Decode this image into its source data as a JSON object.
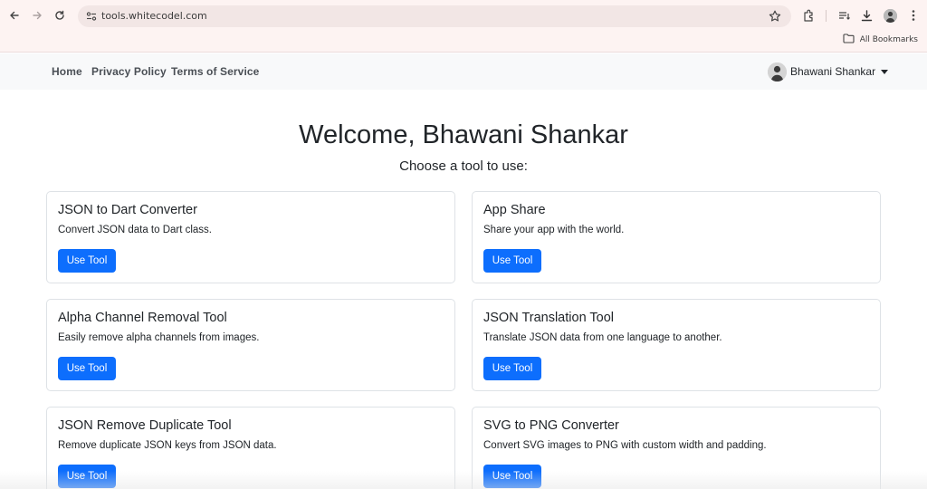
{
  "browser": {
    "url": "tools.whitecodel.com",
    "bookmarks_label": "All Bookmarks",
    "icons": [
      "back-icon",
      "forward-icon",
      "reload-icon",
      "site-info-icon",
      "bookmark-star-icon",
      "extensions-icon",
      "reading-list-icon",
      "download-icon",
      "profile-avatar",
      "more-menu-icon",
      "folder-icon"
    ]
  },
  "navbar": {
    "links": [
      "Home",
      "Privacy Policy",
      "Terms of Service"
    ],
    "user_name": "Bhawani Shankar"
  },
  "main": {
    "title": "Welcome, Bhawani Shankar",
    "subtitle": "Choose a tool to use:",
    "button_label": "Use Tool",
    "tools": [
      {
        "title": "JSON to Dart Converter",
        "description": "Convert JSON data to Dart class."
      },
      {
        "title": "App Share",
        "description": "Share your app with the world."
      },
      {
        "title": "Alpha Channel Removal Tool",
        "description": "Easily remove alpha channels from images."
      },
      {
        "title": "JSON Translation Tool",
        "description": "Translate JSON data from one language to another."
      },
      {
        "title": "JSON Remove Duplicate Tool",
        "description": "Remove duplicate JSON keys from JSON data."
      },
      {
        "title": "SVG to PNG Converter",
        "description": "Convert SVG images to PNG with custom width and padding."
      }
    ]
  },
  "colors": {
    "primary": "#0d6efd",
    "navbar_bg": "#f8f9fa",
    "chrome_bg": "#fdf3f2"
  }
}
